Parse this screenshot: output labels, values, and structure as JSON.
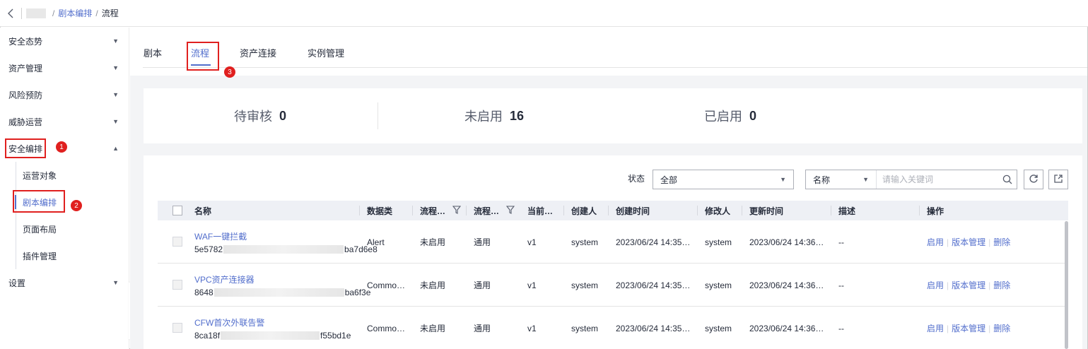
{
  "breadcrumb": {
    "back_icon": "chevron-left-icon",
    "items": [
      "剧本编排",
      "流程"
    ]
  },
  "sidebar": {
    "items": [
      {
        "label": "安全态势",
        "expanded": false
      },
      {
        "label": "资产管理",
        "expanded": false
      },
      {
        "label": "风险预防",
        "expanded": false
      },
      {
        "label": "威胁运营",
        "expanded": false
      },
      {
        "label": "安全编排",
        "expanded": true
      },
      {
        "label": "设置",
        "expanded": false
      }
    ],
    "sub_items": [
      "运营对象",
      "剧本编排",
      "页面布局",
      "插件管理"
    ],
    "active_sub_item": "剧本编排"
  },
  "annotations": [
    "1",
    "2",
    "3"
  ],
  "tabs": [
    "剧本",
    "流程",
    "资产连接",
    "实例管理"
  ],
  "active_tab": "流程",
  "stats": [
    {
      "label": "待审核",
      "value": "0"
    },
    {
      "label": "未启用",
      "value": "16"
    },
    {
      "label": "已启用",
      "value": "0"
    }
  ],
  "filters": {
    "status_label": "状态",
    "status_value": "全部",
    "search_field": "名称",
    "search_placeholder": "请输入关键词"
  },
  "table": {
    "columns": [
      "名称",
      "数据类",
      "流程…",
      "流程…",
      "当前…",
      "创建人",
      "创建时间",
      "修改人",
      "更新时间",
      "描述",
      "操作"
    ],
    "rows": [
      {
        "name": "WAF一键拦截",
        "id_prefix": "5e5782",
        "id_suffix": "ba7d6e8",
        "data_class": "Alert",
        "status": "未启用",
        "type": "通用",
        "version": "v1",
        "creator": "system",
        "created": "2023/06/24 14:35…",
        "modifier": "system",
        "updated": "2023/06/24 14:36…",
        "desc": "--"
      },
      {
        "name": "VPC资产连接器",
        "id_prefix": "8648",
        "id_suffix": "ba6f3e",
        "data_class": "Commo…",
        "status": "未启用",
        "type": "通用",
        "version": "v1",
        "creator": "system",
        "created": "2023/06/24 14:35…",
        "modifier": "system",
        "updated": "2023/06/24 14:36…",
        "desc": "--"
      },
      {
        "name": "CFW首次外联告警",
        "id_prefix": "8ca18f",
        "id_suffix": "f55bd1e",
        "data_class": "Commo…",
        "status": "未启用",
        "type": "通用",
        "version": "v1",
        "creator": "system",
        "created": "2023/06/24 14:35…",
        "modifier": "system",
        "updated": "2023/06/24 14:36…",
        "desc": "--"
      }
    ],
    "actions": [
      "启用",
      "版本管理",
      "删除"
    ]
  },
  "colors": {
    "accent": "#526ecc",
    "annotation": "#e0201f"
  }
}
